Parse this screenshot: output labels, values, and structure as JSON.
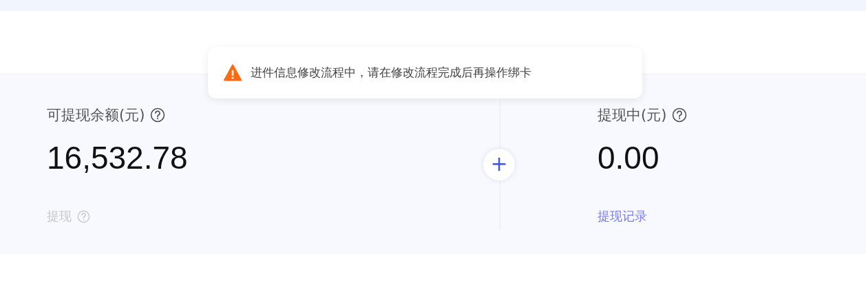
{
  "toast": {
    "kind": "warning",
    "message": "进件信息修改流程中，请在修改流程完成后再操作绑卡"
  },
  "balances": [
    {
      "label": "可提现余额(元)",
      "help": true,
      "amount": "16,532.78",
      "action": {
        "kind": "button",
        "text": "提现",
        "disabled": true,
        "help": true
      }
    },
    {
      "label": "提现中(元)",
      "help": true,
      "amount": "0.00",
      "action": {
        "kind": "link",
        "text": "提现记录",
        "disabled": false,
        "help": false
      }
    }
  ],
  "separator": {
    "symbol": "+"
  }
}
